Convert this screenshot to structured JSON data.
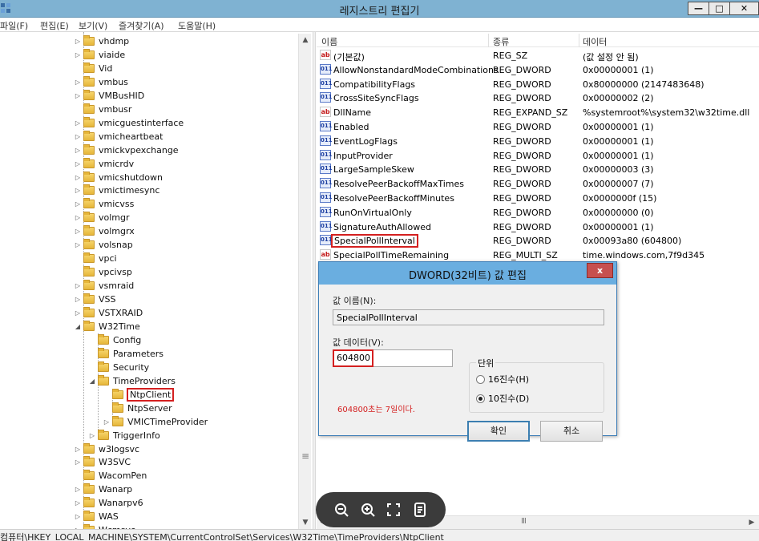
{
  "window": {
    "title": "레지스트리 편집기",
    "min_glyph": "—",
    "max_glyph": "□",
    "close_glyph": "✕"
  },
  "menu": [
    "파일(F)",
    "편집(E)",
    "보기(V)",
    "즐겨찾기(A)",
    "도움말(H)"
  ],
  "tree": [
    {
      "label": "vhdmp",
      "expander": "▷"
    },
    {
      "label": "viaide",
      "expander": "▷"
    },
    {
      "label": "Vid",
      "expander": ""
    },
    {
      "label": "vmbus",
      "expander": "▷"
    },
    {
      "label": "VMBusHID",
      "expander": "▷"
    },
    {
      "label": "vmbusr",
      "expander": ""
    },
    {
      "label": "vmicguestinterface",
      "expander": "▷"
    },
    {
      "label": "vmicheartbeat",
      "expander": "▷"
    },
    {
      "label": "vmickvpexchange",
      "expander": "▷"
    },
    {
      "label": "vmicrdv",
      "expander": "▷"
    },
    {
      "label": "vmicshutdown",
      "expander": "▷"
    },
    {
      "label": "vmictimesync",
      "expander": "▷"
    },
    {
      "label": "vmicvss",
      "expander": "▷"
    },
    {
      "label": "volmgr",
      "expander": "▷"
    },
    {
      "label": "volmgrx",
      "expander": "▷"
    },
    {
      "label": "volsnap",
      "expander": "▷"
    },
    {
      "label": "vpci",
      "expander": ""
    },
    {
      "label": "vpcivsp",
      "expander": ""
    },
    {
      "label": "vsmraid",
      "expander": "▷"
    },
    {
      "label": "VSS",
      "expander": "▷"
    },
    {
      "label": "VSTXRAID",
      "expander": "▷"
    },
    {
      "label": "W32Time",
      "expander": "◢"
    },
    {
      "label": "Config",
      "expander": ""
    },
    {
      "label": "Parameters",
      "expander": ""
    },
    {
      "label": "Security",
      "expander": ""
    },
    {
      "label": "TimeProviders",
      "expander": "◢"
    },
    {
      "label": "NtpClient",
      "expander": ""
    },
    {
      "label": "NtpServer",
      "expander": ""
    },
    {
      "label": "VMICTimeProvider",
      "expander": "▷"
    },
    {
      "label": "TriggerInfo",
      "expander": "▷"
    },
    {
      "label": "w3logsvc",
      "expander": "▷"
    },
    {
      "label": "W3SVC",
      "expander": "▷"
    },
    {
      "label": "WacomPen",
      "expander": ""
    },
    {
      "label": "Wanarp",
      "expander": "▷"
    },
    {
      "label": "Wanarpv6",
      "expander": "▷"
    },
    {
      "label": "WAS",
      "expander": "▷"
    },
    {
      "label": "Wcmsvc",
      "expander": "▷"
    }
  ],
  "tree_selected": "NtpClient",
  "list": {
    "headers": {
      "name": "이름",
      "type": "종류",
      "data": "데이터"
    },
    "rows": [
      {
        "icon": "ab",
        "name": "(기본값)",
        "type": "REG_SZ",
        "data": "(값 설정 안 됨)"
      },
      {
        "icon": "bin",
        "name": "AllowNonstandardModeCombinations",
        "type": "REG_DWORD",
        "data": "0x00000001 (1)"
      },
      {
        "icon": "bin",
        "name": "CompatibilityFlags",
        "type": "REG_DWORD",
        "data": "0x80000000 (2147483648)"
      },
      {
        "icon": "bin",
        "name": "CrossSiteSyncFlags",
        "type": "REG_DWORD",
        "data": "0x00000002 (2)"
      },
      {
        "icon": "ab",
        "name": "DllName",
        "type": "REG_EXPAND_SZ",
        "data": "%systemroot%\\system32\\w32time.dll"
      },
      {
        "icon": "bin",
        "name": "Enabled",
        "type": "REG_DWORD",
        "data": "0x00000001 (1)"
      },
      {
        "icon": "bin",
        "name": "EventLogFlags",
        "type": "REG_DWORD",
        "data": "0x00000001 (1)"
      },
      {
        "icon": "bin",
        "name": "InputProvider",
        "type": "REG_DWORD",
        "data": "0x00000001 (1)"
      },
      {
        "icon": "bin",
        "name": "LargeSampleSkew",
        "type": "REG_DWORD",
        "data": "0x00000003 (3)"
      },
      {
        "icon": "bin",
        "name": "ResolvePeerBackoffMaxTimes",
        "type": "REG_DWORD",
        "data": "0x00000007 (7)"
      },
      {
        "icon": "bin",
        "name": "ResolvePeerBackoffMinutes",
        "type": "REG_DWORD",
        "data": "0x0000000f (15)"
      },
      {
        "icon": "bin",
        "name": "RunOnVirtualOnly",
        "type": "REG_DWORD",
        "data": "0x00000000 (0)"
      },
      {
        "icon": "bin",
        "name": "SignatureAuthAllowed",
        "type": "REG_DWORD",
        "data": "0x00000001 (1)"
      },
      {
        "icon": "bin",
        "name": "SpecialPollInterval",
        "type": "REG_DWORD",
        "data": "0x00093a80 (604800)"
      },
      {
        "icon": "ab",
        "name": "SpecialPollTimeRemaining",
        "type": "REG_MULTI_SZ",
        "data": "time.windows.com,7f9d345"
      }
    ],
    "highlighted_row": "SpecialPollInterval"
  },
  "dialog": {
    "title": "DWORD(32비트) 값 편집",
    "close_glyph": "x",
    "value_name_label": "값 이름(N):",
    "value_name": "SpecialPollInterval",
    "value_data_label": "값 데이터(V):",
    "value_data": "604800",
    "base_label": "단위",
    "radio_hex": "16진수(H)",
    "radio_dec": "10진수(D)",
    "selected_base": "10진수(D)",
    "note": "604800초는 7일이다.",
    "ok": "확인",
    "cancel": "취소"
  },
  "viewer_toolbar": [
    "zoom-out-icon",
    "zoom-in-icon",
    "fit-screen-icon",
    "notes-icon"
  ],
  "status_path": "컴퓨터\\HKEY_LOCAL_MACHINE\\SYSTEM\\CurrentControlSet\\Services\\W32Time\\TimeProviders\\NtpClient",
  "colors": {
    "titlebar": "#7fb2d2",
    "dialog_title": "#6aaee0",
    "highlight": "#d42020",
    "note": "#d42020"
  }
}
